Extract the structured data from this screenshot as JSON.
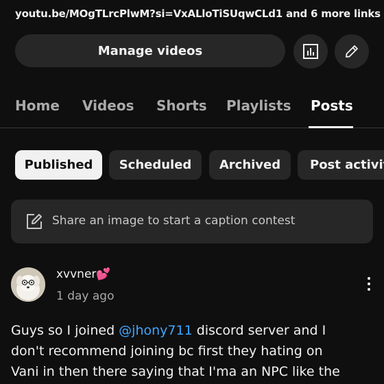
{
  "links_line": "youtu.be/MOgTLrcPlwM?si=VxALloTiSUqwCLd1 and 6 more links",
  "actions": {
    "manage_label": "Manage videos",
    "analytics_icon": "bar-chart-icon",
    "edit_icon": "pencil-icon"
  },
  "tabs": [
    {
      "label": "Home",
      "active": false
    },
    {
      "label": "Videos",
      "active": false
    },
    {
      "label": "Shorts",
      "active": false
    },
    {
      "label": "Playlists",
      "active": false
    },
    {
      "label": "Posts",
      "active": true
    }
  ],
  "filters": [
    {
      "label": "Published",
      "active": true
    },
    {
      "label": "Scheduled",
      "active": false
    },
    {
      "label": "Archived",
      "active": false
    },
    {
      "label": "Post activit",
      "active": false
    }
  ],
  "caption_prompt": {
    "icon": "edit-square-icon",
    "text": "Share an image to start a caption contest"
  },
  "post": {
    "author": "xvvner💕",
    "time": "1 day ago",
    "body_lines": [
      {
        "before": "Guys so I joined ",
        "mention": "@jhony711",
        "after": " discord server and I"
      },
      {
        "text": "don't recommend joining bc first they hating on"
      },
      {
        "text": "Vani in then there saying that I'ma an NPC like the"
      }
    ],
    "menu_icon": "more-vert-icon"
  },
  "colors": {
    "background": "#0f0f0f",
    "surface": "#272727",
    "text": "#f1f1f1",
    "secondary_text": "#aaaaaa",
    "mention": "#3ea6ff"
  }
}
